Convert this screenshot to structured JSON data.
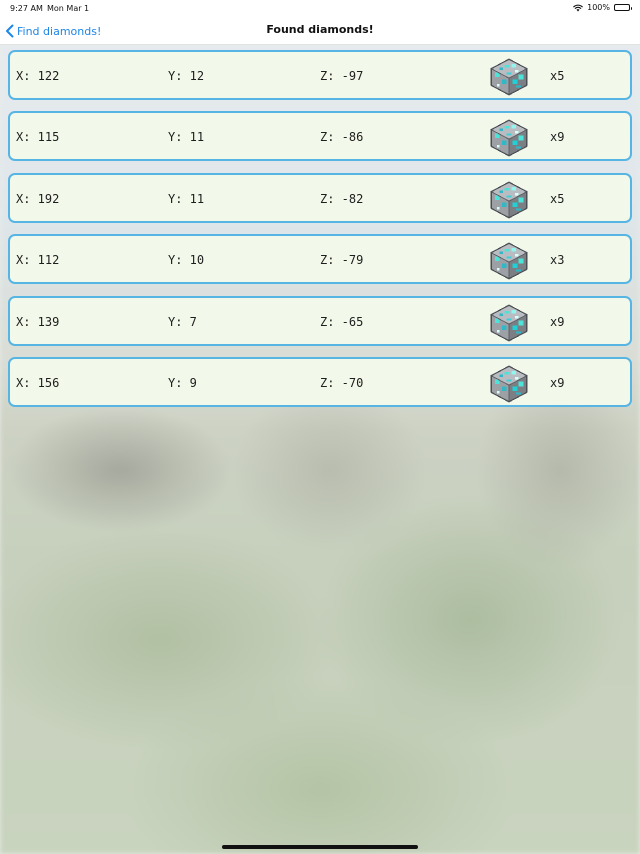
{
  "status_bar": {
    "time": "9:27 AM",
    "date": "Mon Mar 1",
    "battery": "100%",
    "wifi_icon": "wifi-icon",
    "battery_icon": "battery-icon"
  },
  "nav": {
    "back_label": "Find diamonds!",
    "back_icon": "chevron-left-icon",
    "title": "Found diamonds!",
    "accent_color": "#1d86e8"
  },
  "rows": [
    {
      "x": "X: 122",
      "y": "Y: 12",
      "z": "Z: -97",
      "count": "x5",
      "icon": "diamond-ore-icon"
    },
    {
      "x": "X: 115",
      "y": "Y: 11",
      "z": "Z: -86",
      "count": "x9",
      "icon": "diamond-ore-icon"
    },
    {
      "x": "X: 192",
      "y": "Y: 11",
      "z": "Z: -82",
      "count": "x5",
      "icon": "diamond-ore-icon"
    },
    {
      "x": "X: 112",
      "y": "Y: 10",
      "z": "Z: -79",
      "count": "x3",
      "icon": "diamond-ore-icon"
    },
    {
      "x": "X: 139",
      "y": "Y: 7",
      "z": "Z: -65",
      "count": "x9",
      "icon": "diamond-ore-icon"
    },
    {
      "x": "X: 156",
      "y": "Y: 9",
      "z": "Z: -70",
      "count": "x9",
      "icon": "diamond-ore-icon"
    }
  ],
  "colors": {
    "row_background": "#f3f9ea",
    "row_border": "#57b5e4"
  }
}
